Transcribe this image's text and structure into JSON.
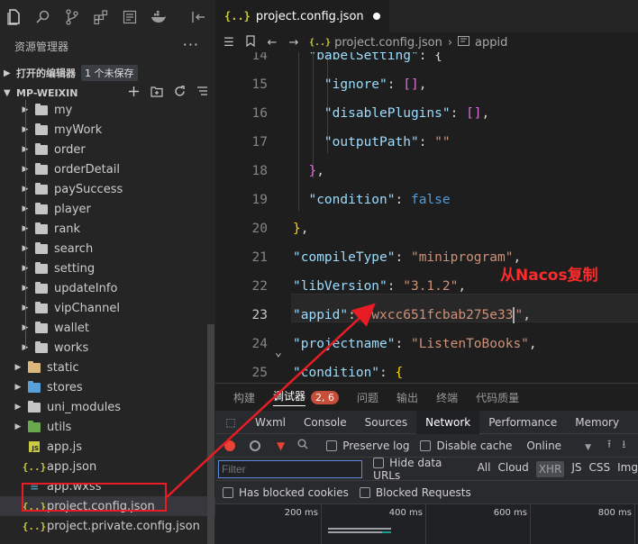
{
  "editor_tab": {
    "title": "project.config.json"
  },
  "breadcrumb": {
    "file": "project.config.json",
    "symbol": "appid"
  },
  "explorer": {
    "title": "资源管理器",
    "more": "···",
    "open_editors": "打开的编辑器",
    "unsaved_badge": "1 个未保存",
    "project": "MP-WEIXIN"
  },
  "tree": [
    {
      "label": "my",
      "kind": "folder",
      "depth": 2
    },
    {
      "label": "myWork",
      "kind": "folder",
      "depth": 2
    },
    {
      "label": "order",
      "kind": "folder",
      "depth": 2
    },
    {
      "label": "orderDetail",
      "kind": "folder",
      "depth": 2
    },
    {
      "label": "paySuccess",
      "kind": "folder",
      "depth": 2
    },
    {
      "label": "player",
      "kind": "folder",
      "depth": 2
    },
    {
      "label": "rank",
      "kind": "folder",
      "depth": 2
    },
    {
      "label": "search",
      "kind": "folder",
      "depth": 2
    },
    {
      "label": "setting",
      "kind": "folder",
      "depth": 2
    },
    {
      "label": "updateInfo",
      "kind": "folder",
      "depth": 2
    },
    {
      "label": "vipChannel",
      "kind": "folder",
      "depth": 2
    },
    {
      "label": "wallet",
      "kind": "folder",
      "depth": 2
    },
    {
      "label": "works",
      "kind": "folder",
      "depth": 2
    },
    {
      "label": "static",
      "kind": "folder-yellow",
      "depth": 1
    },
    {
      "label": "stores",
      "kind": "folder-blue",
      "depth": 1
    },
    {
      "label": "uni_modules",
      "kind": "folder",
      "depth": 1
    },
    {
      "label": "utils",
      "kind": "folder-green",
      "depth": 1
    },
    {
      "label": "app.js",
      "kind": "js",
      "depth": 1
    },
    {
      "label": "app.json",
      "kind": "json",
      "depth": 1
    },
    {
      "label": "app.wxss",
      "kind": "css",
      "depth": 1
    },
    {
      "label": "project.config.json",
      "kind": "json",
      "depth": 1,
      "selected": true
    },
    {
      "label": "project.private.config.json",
      "kind": "json",
      "depth": 1
    }
  ],
  "code": {
    "lines": [
      {
        "n": "14",
        "html": "  <span class='k'>\"babelSetting\"</span><span class='p'>: {</span>"
      },
      {
        "n": "15",
        "html": "    <span class='k'>\"ignore\"</span><span class='p'>: </span><span class='bp'>[]</span><span class='p'>,</span>"
      },
      {
        "n": "16",
        "html": "    <span class='k'>\"disablePlugins\"</span><span class='p'>: </span><span class='bp'>[]</span><span class='p'>,</span>"
      },
      {
        "n": "17",
        "html": "    <span class='k'>\"outputPath\"</span><span class='p'>: </span><span class='s'>\"\"</span>"
      },
      {
        "n": "18",
        "html": "  <span class='bp'>}</span><span class='p'>,</span>"
      },
      {
        "n": "19",
        "html": "  <span class='k'>\"condition\"</span><span class='p'>: </span><span class='b'>false</span>"
      },
      {
        "n": "20",
        "html": "<span class='by'>}</span><span class='p'>,</span>"
      },
      {
        "n": "21",
        "html": "<span class='k'>\"compileType\"</span><span class='p'>: </span><span class='s'>\"miniprogram\"</span><span class='p'>,</span>"
      },
      {
        "n": "22",
        "html": "<span class='k'>\"libVersion\"</span><span class='p'>: </span><span class='s'>\"3.1.2\"</span><span class='p'>,</span>"
      },
      {
        "n": "23",
        "html": "<span class='k'>\"appid\"</span><span class='p'>: </span><span class='s'>\"wxcc651fcbab275e33</span><span class='caret'></span><span class='s'>\"</span><span class='p'>,</span>"
      },
      {
        "n": "24",
        "html": "<span class='k'>\"projectname\"</span><span class='p'>: </span><span class='s'>\"ListenToBooks\"</span><span class='p'>,</span>"
      },
      {
        "n": "25",
        "html": "<span class='k'>\"condition\"</span><span class='p'>: </span><span class='by'>{</span>"
      }
    ]
  },
  "annotation": "从Nacos复制",
  "panel": {
    "tabs": [
      "构建",
      "调试器",
      "问题",
      "输出",
      "终端",
      "代码质量"
    ],
    "debugger_count": "2, 6"
  },
  "devtools": {
    "tabs": [
      "Wxml",
      "Console",
      "Sources",
      "Network",
      "Performance",
      "Memory"
    ],
    "preserve_log": "Preserve log",
    "disable_cache": "Disable cache",
    "throttle": "Online",
    "filter_placeholder": "Filter",
    "hide_data_urls": "Hide data URLs",
    "types": [
      "All",
      "Cloud",
      "XHR",
      "JS",
      "CSS",
      "Img"
    ],
    "has_blocked_cookies": "Has blocked cookies",
    "blocked_requests": "Blocked Requests",
    "timeline_ticks": [
      "200 ms",
      "400 ms",
      "600 ms",
      "800 ms"
    ]
  },
  "colors": {
    "annotation": "#ff2b2b",
    "accent": "#007acc"
  }
}
